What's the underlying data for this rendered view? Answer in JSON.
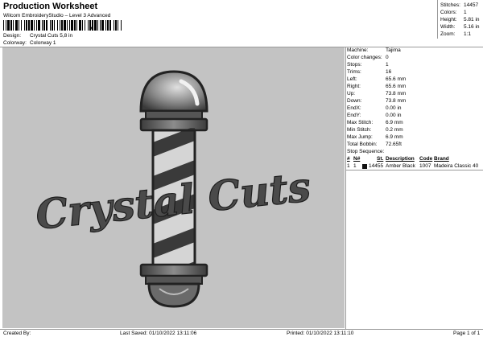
{
  "header": {
    "title": "Production Worksheet",
    "subtitle": "Wilcom EmbroideryStudio – Level 3 Advanced",
    "barcode_mark": ","
  },
  "design_info": [
    {
      "label": "Design:",
      "value": "Crystal Cuts 5,8 in"
    },
    {
      "label": "Colorway:",
      "value": "Colorway 1"
    }
  ],
  "top_stats": [
    {
      "label": "Stitches:",
      "value": "14457"
    },
    {
      "label": "Colors:",
      "value": "1"
    },
    {
      "label": "Height:",
      "value": "5.81 in"
    },
    {
      "label": "Width:",
      "value": "5.16 in"
    },
    {
      "label": "Zoom:",
      "value": "1:1"
    }
  ],
  "machine_stats": [
    {
      "label": "Machine:",
      "value": "Tajima"
    },
    {
      "label": "Color changes:",
      "value": "0"
    },
    {
      "label": "Stops:",
      "value": "1"
    },
    {
      "label": "Trims:",
      "value": "16"
    },
    {
      "label": "Left:",
      "value": "65.6 mm"
    },
    {
      "label": "Right:",
      "value": "65.6 mm"
    },
    {
      "label": "Up:",
      "value": "73.8 mm"
    },
    {
      "label": "Down:",
      "value": "73.8 mm"
    },
    {
      "label": "EndX:",
      "value": "0.00 in"
    },
    {
      "label": "EndY:",
      "value": "0.00 in"
    },
    {
      "label": "Max Stitch:",
      "value": "6.9 mm"
    },
    {
      "label": "Min Stitch:",
      "value": "0.2 mm"
    },
    {
      "label": "Max Jump:",
      "value": "6.9 mm"
    },
    {
      "label": "Total Bobbin:",
      "value": "72.65ft"
    }
  ],
  "stop_sequence": {
    "title": "Stop Sequence:",
    "headers": {
      "num": "#",
      "n": "N#",
      "st": "St.",
      "description": "Description",
      "code": "Code",
      "brand": "Brand"
    },
    "rows": [
      {
        "num": "1",
        "n": "1",
        "color": "#111111",
        "st": "14455",
        "description": "Amber Black",
        "code": "1007",
        "brand": "Madeira Classic 40"
      }
    ]
  },
  "design_text": "Crystal Cuts",
  "footer": {
    "created_by": "Created By:",
    "last_saved": "Last Saved: 01/10/2022 13:11:06",
    "printed": "Printed: 01/10/2022 13:11:10",
    "page": "Page 1 of 1"
  }
}
